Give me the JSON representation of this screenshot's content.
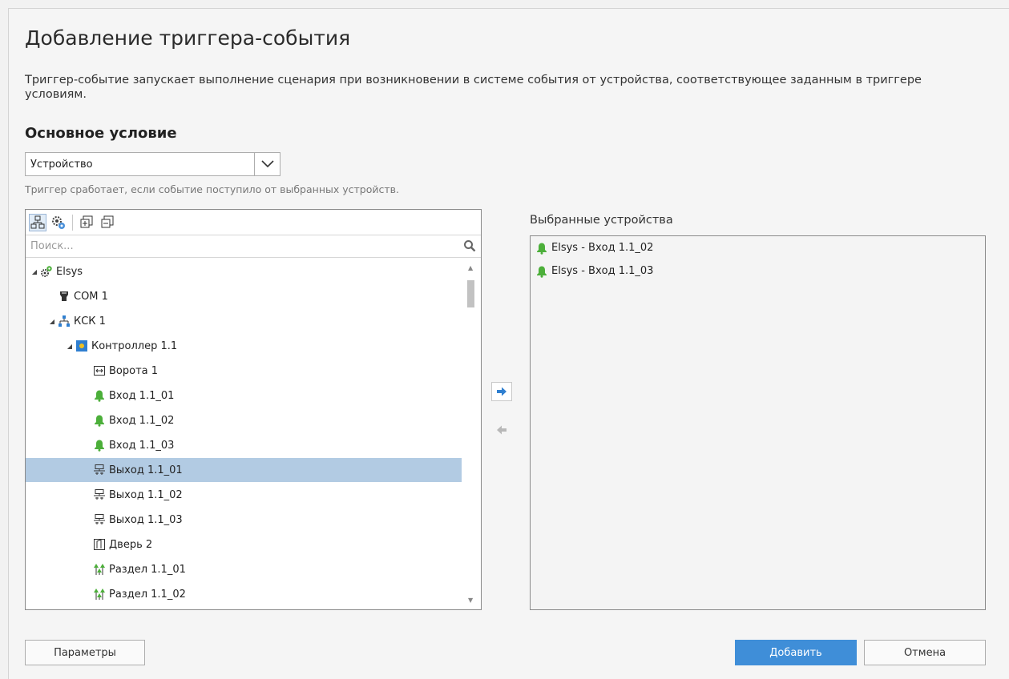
{
  "dialog": {
    "title": "Добавление триггера-события",
    "description": "Триггер-событие запускает выполнение сценария при возникновении в системе события от устройства, соответствующее заданным в триггере условиям."
  },
  "main_condition": {
    "heading": "Основное условие",
    "select_value": "Устройство",
    "hint": "Триггер сработает, если событие поступило от выбранных устройств."
  },
  "tree_panel": {
    "toolbar": [
      "tree-view-icon",
      "device-settings-icon",
      "expand-all-icon",
      "collapse-all-icon"
    ],
    "search_placeholder": "Поиск...",
    "items": [
      {
        "label": "Elsys",
        "icon": "elsys-system-icon",
        "expanded": true,
        "level": 0
      },
      {
        "label": "COM 1",
        "icon": "com-port-icon",
        "expanded": null,
        "level": 1
      },
      {
        "label": "КСК 1",
        "icon": "network-icon",
        "expanded": true,
        "level": 1
      },
      {
        "label": "Контроллер 1.1",
        "icon": "controller-icon",
        "expanded": true,
        "level": 2
      },
      {
        "label": "Ворота 1",
        "icon": "gate-icon",
        "expanded": null,
        "level": 3
      },
      {
        "label": "Вход 1.1_01",
        "icon": "bell-icon",
        "expanded": null,
        "level": 3
      },
      {
        "label": "Вход 1.1_02",
        "icon": "bell-icon",
        "expanded": null,
        "level": 3
      },
      {
        "label": "Вход 1.1_03",
        "icon": "bell-icon",
        "expanded": null,
        "level": 3
      },
      {
        "label": "Выход 1.1_01",
        "icon": "relay-output-icon",
        "expanded": null,
        "level": 3,
        "selected": true
      },
      {
        "label": "Выход 1.1_02",
        "icon": "relay-output-icon",
        "expanded": null,
        "level": 3
      },
      {
        "label": "Выход 1.1_03",
        "icon": "relay-output-icon",
        "expanded": null,
        "level": 3
      },
      {
        "label": "Дверь 2",
        "icon": "door-icon",
        "expanded": null,
        "level": 3
      },
      {
        "label": "Раздел 1.1_01",
        "icon": "partition-icon",
        "expanded": null,
        "level": 3
      },
      {
        "label": "Раздел 1.1_02",
        "icon": "partition-icon",
        "expanded": null,
        "level": 3
      }
    ]
  },
  "selected_panel": {
    "label": "Выбранные устройства",
    "items": [
      {
        "label": "Elsys - Вход 1.1_02",
        "icon": "bell-icon"
      },
      {
        "label": "Elsys - Вход 1.1_03",
        "icon": "bell-icon"
      }
    ]
  },
  "buttons": {
    "params": "Параметры",
    "add": "Добавить",
    "cancel": "Отмена"
  },
  "colors": {
    "accent": "#3f8ed8",
    "selection": "#b2cbe3",
    "bell_green": "#4caf3a"
  }
}
